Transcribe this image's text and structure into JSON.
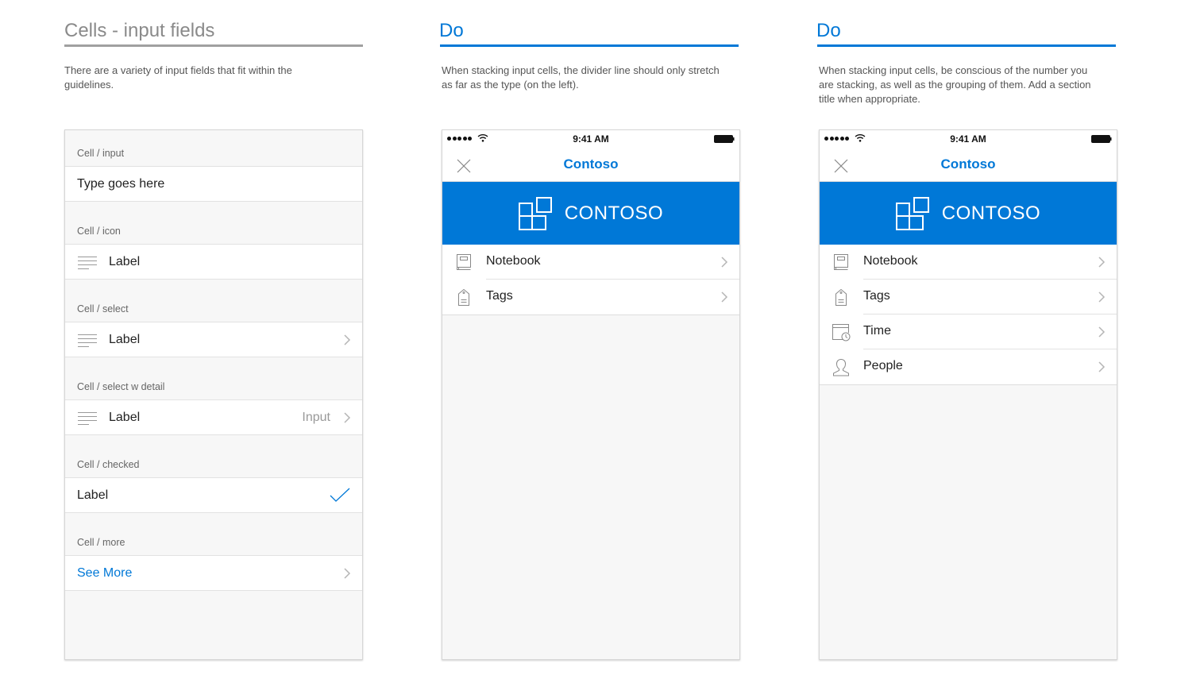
{
  "colors": {
    "accent": "#0078d7",
    "gray_title": "#8a8a8a",
    "panel_bg": "#f7f7f7"
  },
  "columns": [
    {
      "title": "Cells - input fields",
      "description": "There are a variety of input fields that fit within the guidelines.",
      "cells": {
        "input": {
          "header": "Cell / input",
          "value": "Type goes here"
        },
        "icon": {
          "header": "Cell / icon",
          "label": "Label",
          "icon": "lines-icon"
        },
        "select": {
          "header": "Cell / select",
          "label": "Label",
          "icon": "lines-icon",
          "accessory": "chevron-right-icon"
        },
        "select_detail": {
          "header": "Cell / select w detail",
          "label": "Label",
          "detail": "Input",
          "icon": "lines-icon",
          "accessory": "chevron-right-icon"
        },
        "checked": {
          "header": "Cell / checked",
          "label": "Label",
          "accessory": "checkmark-icon"
        },
        "more": {
          "header": "Cell / more",
          "label": "See More",
          "accessory": "chevron-right-icon"
        }
      }
    },
    {
      "title": "Do",
      "description": "When stacking input cells, the divider line should only stretch as far as the type (on the left).",
      "phone": {
        "status_time": "9:41 AM",
        "nav_title": "Contoso",
        "banner_text": "CONTOSO",
        "rows": [
          {
            "label": "Notebook",
            "icon": "notebook-icon"
          },
          {
            "label": "Tags",
            "icon": "tag-icon"
          }
        ]
      }
    },
    {
      "title": "Do",
      "description": "When stacking input cells, be conscious of the number you are stacking, as well as the grouping of them. Add a section title when appropriate.",
      "phone": {
        "status_time": "9:41 AM",
        "nav_title": "Contoso",
        "banner_text": "CONTOSO",
        "rows": [
          {
            "label": "Notebook",
            "icon": "notebook-icon"
          },
          {
            "label": "Tags",
            "icon": "tag-icon"
          },
          {
            "label": "Time",
            "icon": "calendar-clock-icon"
          },
          {
            "label": "People",
            "icon": "person-icon"
          }
        ]
      }
    }
  ]
}
